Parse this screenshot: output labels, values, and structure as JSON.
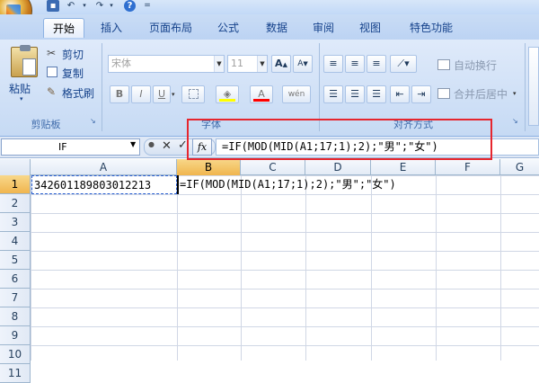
{
  "tabs": [
    "开始",
    "插入",
    "页面布局",
    "公式",
    "数据",
    "审阅",
    "视图",
    "特色功能"
  ],
  "clipboard": {
    "paste": "粘贴",
    "cut": "剪切",
    "copy": "复制",
    "format_painter": "格式刷",
    "group_label": "剪贴板"
  },
  "font": {
    "name": "宋体",
    "size": "11",
    "bold": "B",
    "italic": "I",
    "underline": "U",
    "grow": "A",
    "shrink": "A",
    "font_color": "A",
    "wen": "wén",
    "group_label": "字体"
  },
  "alignment": {
    "wrap_text": "自动换行",
    "merge_center": "合并后居中",
    "group_label": "对齐方式"
  },
  "formula_bar": {
    "name_box": "IF",
    "cancel": "✕",
    "enter": "✓",
    "fx": "fx",
    "formula": "=IF(MOD(MID(A1;17;1);2);\"男\";\"女\")"
  },
  "columns": [
    "A",
    "B",
    "C",
    "D",
    "E",
    "F",
    "G"
  ],
  "rows": [
    "1",
    "2",
    "3",
    "4",
    "5",
    "6",
    "7",
    "8",
    "9",
    "10",
    "11"
  ],
  "cells": {
    "A1": "342601189803012213",
    "B1": "=IF(MOD(MID(A1;17;1);2);\"男\";\"女\")"
  },
  "colors": {
    "highlight_box": "#e6262e",
    "selected_header": "#f0b54e",
    "ribbon_bg": "#c6daf4"
  }
}
